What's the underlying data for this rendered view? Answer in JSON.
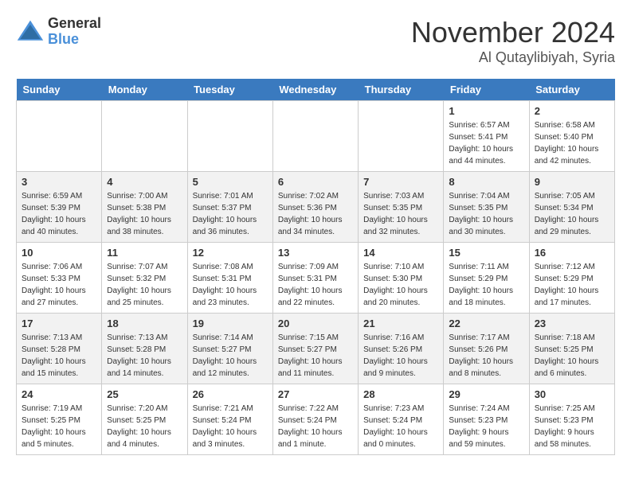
{
  "header": {
    "logo_general": "General",
    "logo_blue": "Blue",
    "month": "November 2024",
    "location": "Al Qutaylibiyah, Syria"
  },
  "weekdays": [
    "Sunday",
    "Monday",
    "Tuesday",
    "Wednesday",
    "Thursday",
    "Friday",
    "Saturday"
  ],
  "weeks": [
    [
      {
        "day": "",
        "info": ""
      },
      {
        "day": "",
        "info": ""
      },
      {
        "day": "",
        "info": ""
      },
      {
        "day": "",
        "info": ""
      },
      {
        "day": "",
        "info": ""
      },
      {
        "day": "1",
        "info": "Sunrise: 6:57 AM\nSunset: 5:41 PM\nDaylight: 10 hours\nand 44 minutes."
      },
      {
        "day": "2",
        "info": "Sunrise: 6:58 AM\nSunset: 5:40 PM\nDaylight: 10 hours\nand 42 minutes."
      }
    ],
    [
      {
        "day": "3",
        "info": "Sunrise: 6:59 AM\nSunset: 5:39 PM\nDaylight: 10 hours\nand 40 minutes."
      },
      {
        "day": "4",
        "info": "Sunrise: 7:00 AM\nSunset: 5:38 PM\nDaylight: 10 hours\nand 38 minutes."
      },
      {
        "day": "5",
        "info": "Sunrise: 7:01 AM\nSunset: 5:37 PM\nDaylight: 10 hours\nand 36 minutes."
      },
      {
        "day": "6",
        "info": "Sunrise: 7:02 AM\nSunset: 5:36 PM\nDaylight: 10 hours\nand 34 minutes."
      },
      {
        "day": "7",
        "info": "Sunrise: 7:03 AM\nSunset: 5:35 PM\nDaylight: 10 hours\nand 32 minutes."
      },
      {
        "day": "8",
        "info": "Sunrise: 7:04 AM\nSunset: 5:35 PM\nDaylight: 10 hours\nand 30 minutes."
      },
      {
        "day": "9",
        "info": "Sunrise: 7:05 AM\nSunset: 5:34 PM\nDaylight: 10 hours\nand 29 minutes."
      }
    ],
    [
      {
        "day": "10",
        "info": "Sunrise: 7:06 AM\nSunset: 5:33 PM\nDaylight: 10 hours\nand 27 minutes."
      },
      {
        "day": "11",
        "info": "Sunrise: 7:07 AM\nSunset: 5:32 PM\nDaylight: 10 hours\nand 25 minutes."
      },
      {
        "day": "12",
        "info": "Sunrise: 7:08 AM\nSunset: 5:31 PM\nDaylight: 10 hours\nand 23 minutes."
      },
      {
        "day": "13",
        "info": "Sunrise: 7:09 AM\nSunset: 5:31 PM\nDaylight: 10 hours\nand 22 minutes."
      },
      {
        "day": "14",
        "info": "Sunrise: 7:10 AM\nSunset: 5:30 PM\nDaylight: 10 hours\nand 20 minutes."
      },
      {
        "day": "15",
        "info": "Sunrise: 7:11 AM\nSunset: 5:29 PM\nDaylight: 10 hours\nand 18 minutes."
      },
      {
        "day": "16",
        "info": "Sunrise: 7:12 AM\nSunset: 5:29 PM\nDaylight: 10 hours\nand 17 minutes."
      }
    ],
    [
      {
        "day": "17",
        "info": "Sunrise: 7:13 AM\nSunset: 5:28 PM\nDaylight: 10 hours\nand 15 minutes."
      },
      {
        "day": "18",
        "info": "Sunrise: 7:13 AM\nSunset: 5:28 PM\nDaylight: 10 hours\nand 14 minutes."
      },
      {
        "day": "19",
        "info": "Sunrise: 7:14 AM\nSunset: 5:27 PM\nDaylight: 10 hours\nand 12 minutes."
      },
      {
        "day": "20",
        "info": "Sunrise: 7:15 AM\nSunset: 5:27 PM\nDaylight: 10 hours\nand 11 minutes."
      },
      {
        "day": "21",
        "info": "Sunrise: 7:16 AM\nSunset: 5:26 PM\nDaylight: 10 hours\nand 9 minutes."
      },
      {
        "day": "22",
        "info": "Sunrise: 7:17 AM\nSunset: 5:26 PM\nDaylight: 10 hours\nand 8 minutes."
      },
      {
        "day": "23",
        "info": "Sunrise: 7:18 AM\nSunset: 5:25 PM\nDaylight: 10 hours\nand 6 minutes."
      }
    ],
    [
      {
        "day": "24",
        "info": "Sunrise: 7:19 AM\nSunset: 5:25 PM\nDaylight: 10 hours\nand 5 minutes."
      },
      {
        "day": "25",
        "info": "Sunrise: 7:20 AM\nSunset: 5:25 PM\nDaylight: 10 hours\nand 4 minutes."
      },
      {
        "day": "26",
        "info": "Sunrise: 7:21 AM\nSunset: 5:24 PM\nDaylight: 10 hours\nand 3 minutes."
      },
      {
        "day": "27",
        "info": "Sunrise: 7:22 AM\nSunset: 5:24 PM\nDaylight: 10 hours\nand 1 minute."
      },
      {
        "day": "28",
        "info": "Sunrise: 7:23 AM\nSunset: 5:24 PM\nDaylight: 10 hours\nand 0 minutes."
      },
      {
        "day": "29",
        "info": "Sunrise: 7:24 AM\nSunset: 5:23 PM\nDaylight: 9 hours\nand 59 minutes."
      },
      {
        "day": "30",
        "info": "Sunrise: 7:25 AM\nSunset: 5:23 PM\nDaylight: 9 hours\nand 58 minutes."
      }
    ]
  ]
}
